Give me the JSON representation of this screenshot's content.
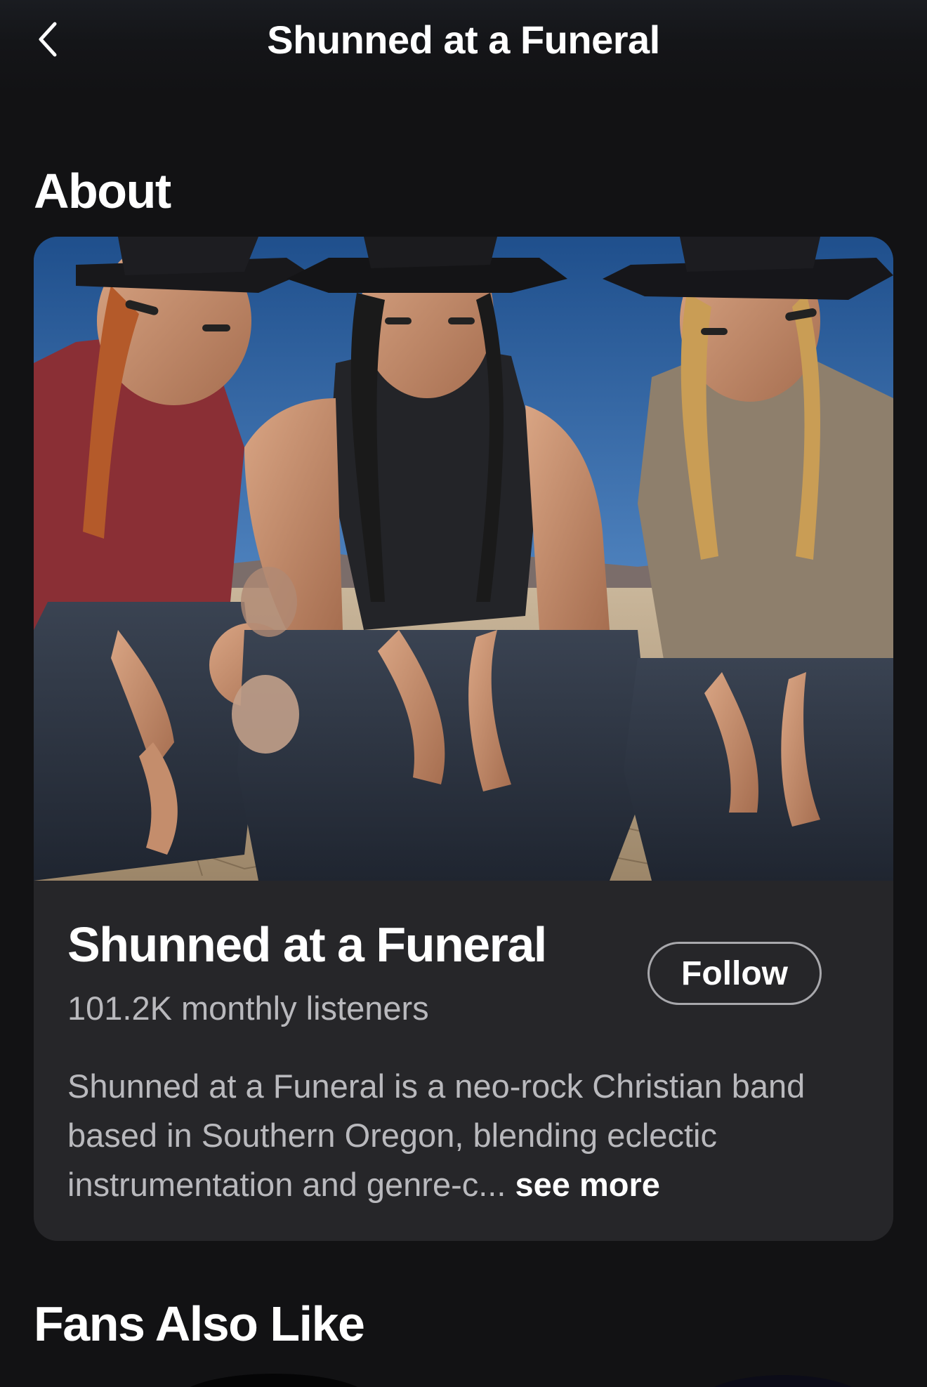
{
  "header": {
    "title": "Shunned at a Funeral",
    "back_icon": "chevron-left-icon"
  },
  "about": {
    "heading": "About",
    "artist_name": "Shunned at a Funeral",
    "monthly_listeners": "101.2K monthly listeners",
    "follow_label": "Follow",
    "bio": "Shunned at a Funeral is a neo-rock Christian band based in Southern Oregon, blending eclectic instrumentation and genre-c...",
    "see_more_label": "see more"
  },
  "fans_also_like": {
    "heading": "Fans Also Like"
  },
  "colors": {
    "background": "#121214",
    "card": "#262629",
    "text_secondary": "#b9b9bd"
  }
}
